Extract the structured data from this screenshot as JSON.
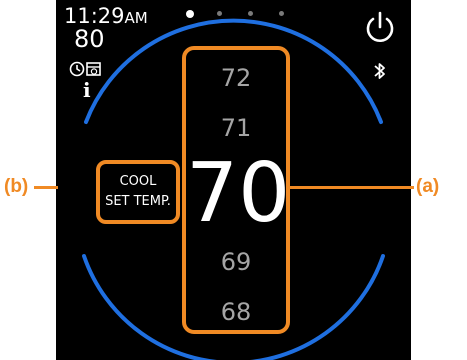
{
  "status": {
    "time": "11:29",
    "ampm": "AM",
    "indoor_temp": "80"
  },
  "pager": {
    "count": 4,
    "active_index": 0
  },
  "icons": {
    "schedule": "schedule-icon",
    "info": "info-icon",
    "info_glyph": "i",
    "power": "power-icon",
    "bluetooth": "bluetooth-icon"
  },
  "setpoint": {
    "options_above": [
      "72",
      "71"
    ],
    "current": "70",
    "options_below": [
      "69",
      "68"
    ]
  },
  "mode": {
    "line1": "COOL",
    "line2": "SET TEMP."
  },
  "callouts": {
    "a": "(a)",
    "b": "(b)"
  },
  "colors": {
    "screen_bg": "#000000",
    "ring": "#1f6fe0",
    "highlight": "#f08a24",
    "text": "#ffffff",
    "muted_text": "#a5a5a5"
  }
}
